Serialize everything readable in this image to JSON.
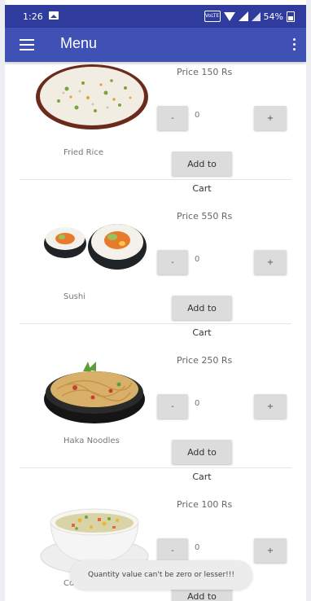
{
  "status_bar": {
    "time": "1:26",
    "battery": "54%"
  },
  "app_bar": {
    "title": "Menu"
  },
  "items": [
    {
      "name": "Fried Rice",
      "price": "Price 150 Rs",
      "quantity": "0",
      "minus": "-",
      "plus": "+",
      "add_to_cart": "Add to Cart"
    },
    {
      "name": "Sushi",
      "price": "Price 550 Rs",
      "quantity": "0",
      "minus": "-",
      "plus": "+",
      "add_to_cart": "Add to Cart"
    },
    {
      "name": "Haka Noodles",
      "price": "Price 250 Rs",
      "quantity": "0",
      "minus": "-",
      "plus": "+",
      "add_to_cart": "Add to Cart"
    },
    {
      "name": "Corn Soup",
      "price": "Price 100 Rs",
      "quantity": "0",
      "minus": "-",
      "plus": "+",
      "add_to_cart": "Add to Cart"
    }
  ],
  "toast": "Quantity value can't be zero or lesser!!!",
  "colors": {
    "status_bar": "#2f3c9e",
    "app_bar": "#3f51b5",
    "button": "#dcdcdc"
  }
}
